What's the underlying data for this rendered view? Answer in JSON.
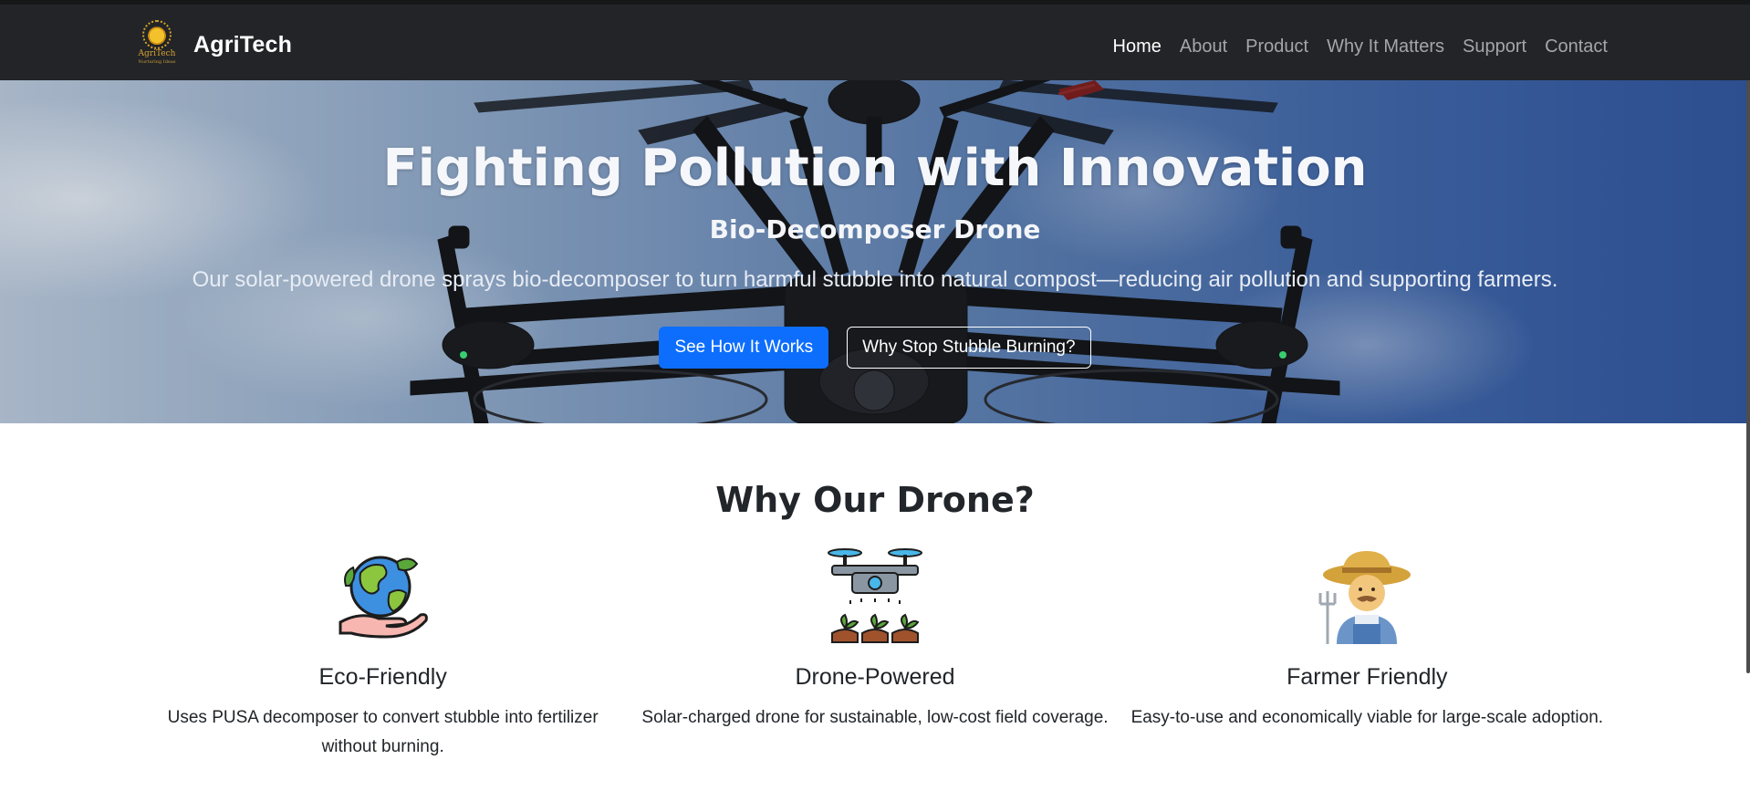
{
  "brand": {
    "logo_name": "AgriTech",
    "logo_tagline": "Nurturing Ideas",
    "name": "AgriTech"
  },
  "nav": {
    "items": [
      {
        "label": "Home",
        "active": true
      },
      {
        "label": "About",
        "active": false
      },
      {
        "label": "Product",
        "active": false
      },
      {
        "label": "Why It Matters",
        "active": false
      },
      {
        "label": "Support",
        "active": false
      },
      {
        "label": "Contact",
        "active": false
      }
    ]
  },
  "hero": {
    "title": "Fighting Pollution with Innovation",
    "subtitle": "Bio-Decomposer Drone",
    "description": "Our solar-powered drone sprays bio-decomposer to turn harmful stubble into natural compost—reducing air pollution and supporting farmers.",
    "primary_button": "See How It Works",
    "secondary_button": "Why Stop Stubble Burning?"
  },
  "features": {
    "title": "Why Our Drone?",
    "items": [
      {
        "icon": "earth-in-hand-icon",
        "title": "Eco-Friendly",
        "text": "Uses PUSA decomposer to convert stubble into fertilizer without burning."
      },
      {
        "icon": "drone-spraying-icon",
        "title": "Drone-Powered",
        "text": "Solar-charged drone for sustainable, low-cost field coverage."
      },
      {
        "icon": "farmer-icon",
        "title": "Farmer Friendly",
        "text": "Easy-to-use and economically viable for large-scale adoption."
      }
    ]
  },
  "colors": {
    "navbar_bg": "#222427",
    "primary": "#0d6efd",
    "nav_active": "#ffffff",
    "nav_inactive": "#a4a6a8"
  }
}
